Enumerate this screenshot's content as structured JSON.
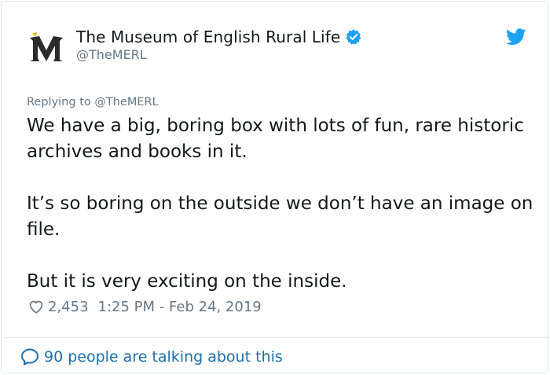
{
  "tweet": {
    "author": {
      "display_name": "The Museum of English Rural Life",
      "handle": "@TheMERL",
      "avatar_letter": "M",
      "verified": true
    },
    "reply_context": {
      "prefix": "Replying to ",
      "mention": "@TheMERL"
    },
    "paragraphs": [
      "We have a big, boring box with lots of fun, rare historic archives and books in it.",
      "It’s so boring on the outside we don’t have an image on file.",
      "But it is very exciting on the inside."
    ],
    "likes": "2,453",
    "timestamp": "1:25 PM - Feb 24, 2019",
    "conversation_label": "90 people are talking about this"
  },
  "icons": {
    "verified": "verified-badge-icon",
    "twitter": "twitter-bird-icon",
    "like": "heart-icon",
    "reply": "speech-bubble-icon"
  },
  "colors": {
    "brand_blue": "#1da1f2",
    "link_blue": "#1b6faa",
    "secondary_text": "#657786",
    "border": "#e1e8ed"
  }
}
